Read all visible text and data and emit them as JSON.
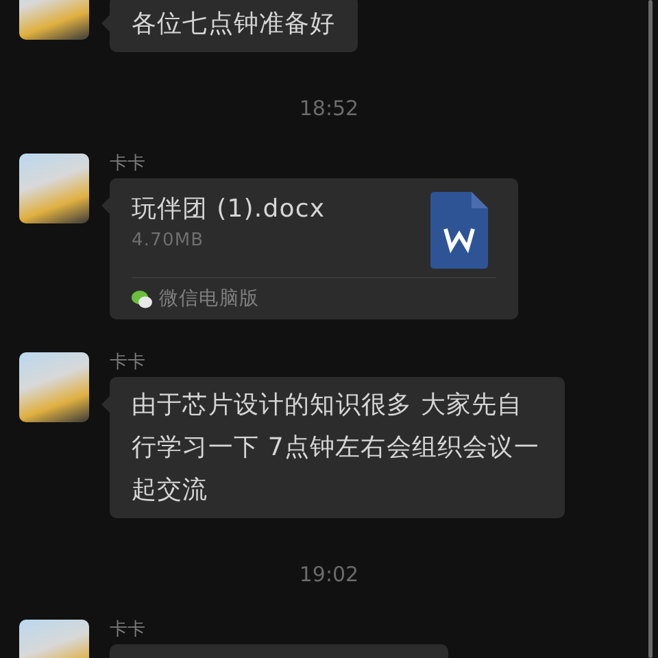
{
  "messages": [
    {
      "kind": "text",
      "text": "各位七点钟准备好"
    },
    {
      "kind": "time",
      "text": "18:52"
    },
    {
      "kind": "file",
      "sender": "卡卡",
      "file_name": "玩伴团 (1).docx",
      "file_size": "4.70MB",
      "source": "微信电脑版"
    },
    {
      "kind": "text",
      "sender": "卡卡",
      "text": "由于芯片设计的知识很多 大家先自行学习一下 7点钟左右会组织会议一起交流"
    },
    {
      "kind": "time",
      "text": "19:02"
    },
    {
      "kind": "text",
      "sender": "卡卡"
    }
  ]
}
